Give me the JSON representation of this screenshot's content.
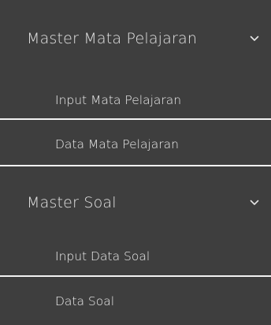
{
  "sidebar": {
    "groups": [
      {
        "label": "Master Mata Pelajaran",
        "items": [
          {
            "label": "Input Mata Pelajaran"
          },
          {
            "label": "Data Mata Pelajaran"
          }
        ]
      },
      {
        "label": "Master Soal",
        "items": [
          {
            "label": "Input Data Soal"
          },
          {
            "label": "Data Soal"
          }
        ]
      }
    ]
  },
  "colors": {
    "background": "#3e3e3e",
    "text": "#ffffff",
    "divider": "#f2f2f2"
  },
  "icons": {
    "group_toggle": "chevron-down-icon"
  }
}
